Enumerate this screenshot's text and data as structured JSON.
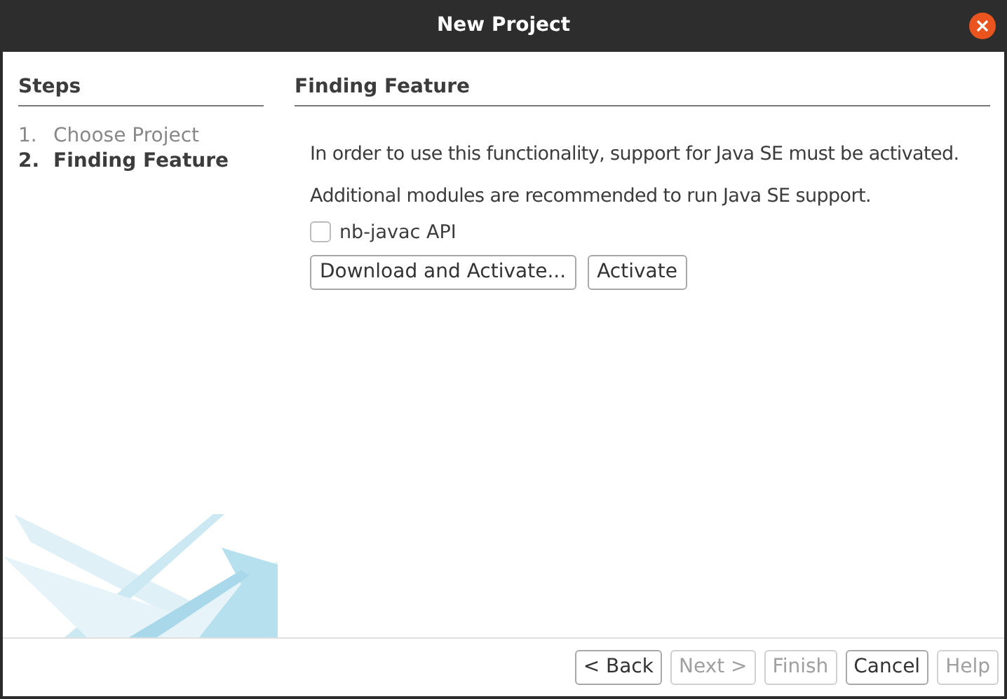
{
  "window": {
    "title": "New Project"
  },
  "steps": {
    "heading": "Steps",
    "items": [
      {
        "number": "1.",
        "label": "Choose Project",
        "selected": false
      },
      {
        "number": "2.",
        "label": "Finding Feature",
        "selected": true
      }
    ]
  },
  "panel": {
    "heading": "Finding Feature",
    "message": "In order to use this functionality, support for Java SE must be activated.",
    "note": "Additional modules are recommended to run Java SE support.",
    "checkbox": {
      "label": "nb-javac API",
      "checked": false
    },
    "buttons": [
      {
        "label": "Download and Activate..."
      },
      {
        "label": "Activate"
      }
    ]
  },
  "footer_buttons": [
    {
      "label": "< Back",
      "disabled": false
    },
    {
      "label": "Next >",
      "disabled": true
    },
    {
      "label": "Finish",
      "disabled": true
    },
    {
      "label": "Cancel",
      "disabled": false
    },
    {
      "label": "Help",
      "disabled": true
    }
  ]
}
